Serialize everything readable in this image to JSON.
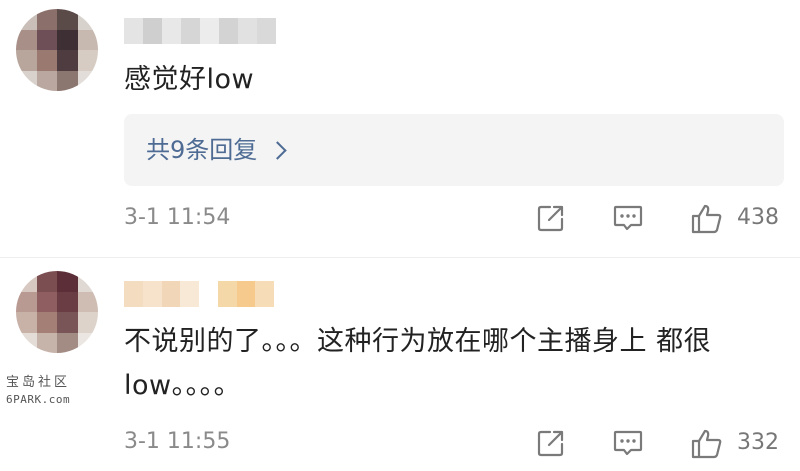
{
  "comments": [
    {
      "text": "感觉好low",
      "reply_summary": "共9条回复",
      "time": "3-1 11:54",
      "likes": "438",
      "icons": [
        "share-icon",
        "comment-icon",
        "like-icon",
        "chevron-right-icon"
      ]
    },
    {
      "text": "不说别的了。。。这种行为放在哪个主播身上 都很low。。。。",
      "time": "3-1 11:55",
      "likes": "332",
      "icons": [
        "share-icon",
        "comment-icon",
        "like-icon"
      ]
    }
  ],
  "watermark": {
    "top": "宝岛社区",
    "bottom": "6PARK.com"
  },
  "colors": {
    "reply_link": "#4e6b94",
    "reply_box": "#f4f4f4",
    "meta_text": "#8a8a8a",
    "body_text": "#222222"
  }
}
